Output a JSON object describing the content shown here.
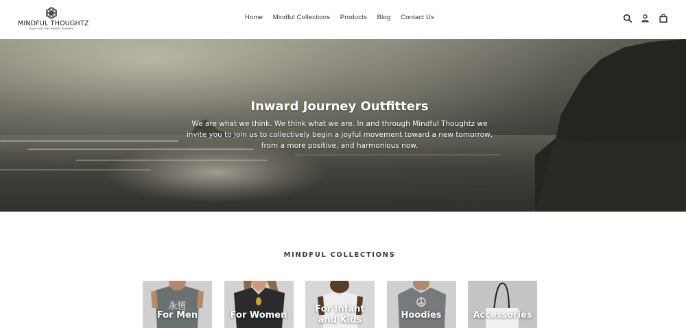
{
  "brand": {
    "name": "MINDFUL THOUGHTZ",
    "tagline": "BALM FOR THE INWARD JOURNEY"
  },
  "nav": {
    "items": [
      "Home",
      "Mindful Collections",
      "Products",
      "Blog",
      "Contact Us"
    ]
  },
  "header_icons": [
    "search-icon",
    "account-icon",
    "cart-icon"
  ],
  "hero": {
    "title": "Inward Journey Outfitters",
    "text": "We are what we think. We think what we are. In and through Mindful Thoughtz we invite you to join us to collectively begin a joyful movement toward a new tomorrow, from a more positive, and harmonious now."
  },
  "collections": {
    "title": "MINDFUL COLLECTIONS",
    "items": [
      {
        "label": "For Men",
        "shirt_text": "永恆"
      },
      {
        "label": "For Women"
      },
      {
        "label": "For Infant and Kids"
      },
      {
        "label": "Hoodies"
      },
      {
        "label": "Accessories"
      }
    ]
  }
}
